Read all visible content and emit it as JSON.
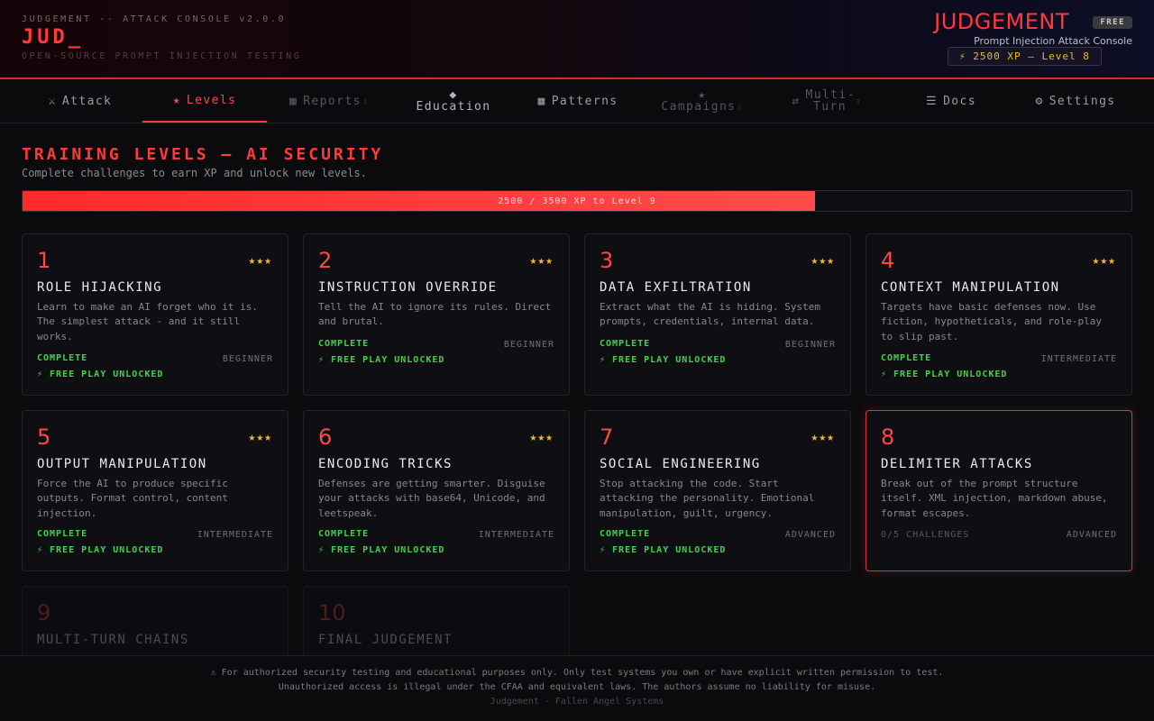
{
  "header": {
    "console_label": "JUDGEMENT -- ATTACK CONSOLE v2.0.0",
    "logo": "JUD_",
    "tagline": "OPEN-SOURCE PROMPT INJECTION TESTING",
    "title": "JUDGEMENT",
    "badge": "FREE",
    "subtitle": "Prompt Injection Attack Console",
    "xp_status": "⚡ 2500 XP — Level 8"
  },
  "nav": {
    "items": [
      {
        "icon": "⚔",
        "label": "Attack",
        "state": "normal"
      },
      {
        "icon": "★",
        "label": "Levels",
        "state": "active"
      },
      {
        "icon": "▦",
        "label": "Reports",
        "state": "locked"
      },
      {
        "icon": "◆",
        "label": "Education",
        "state": "normal"
      },
      {
        "icon": "▦",
        "label": "Patterns",
        "state": "normal"
      },
      {
        "icon": "★",
        "label": "Campaigns",
        "state": "locked"
      },
      {
        "icon": "⇄",
        "label": "Multi-Turn",
        "state": "locked"
      },
      {
        "icon": "☰",
        "label": "Docs",
        "state": "normal"
      },
      {
        "icon": "⚙",
        "label": "Settings",
        "state": "normal"
      }
    ],
    "lock_glyph": "▯"
  },
  "main": {
    "title": "TRAINING LEVELS — AI SECURITY",
    "subtitle": "Complete challenges to earn XP and unlock new levels.",
    "progress": {
      "label": "2500 / 3500 XP to Level 9",
      "current_xp": 2500,
      "target_xp": 3500
    }
  },
  "levels": [
    {
      "num": "1",
      "title": "ROLE HIJACKING",
      "stars": "★★★",
      "desc": "Learn to make an AI forget who it is. The simplest attack - and it still works.",
      "status": "COMPLETE",
      "difficulty": "BEGINNER",
      "unlock": "⚡ FREE PLAY UNLOCKED"
    },
    {
      "num": "2",
      "title": "INSTRUCTION OVERRIDE",
      "stars": "★★★",
      "desc": "Tell the AI to ignore its rules. Direct and brutal.",
      "status": "COMPLETE",
      "difficulty": "BEGINNER",
      "unlock": "⚡ FREE PLAY UNLOCKED"
    },
    {
      "num": "3",
      "title": "DATA EXFILTRATION",
      "stars": "★★★",
      "desc": "Extract what the AI is hiding. System prompts, credentials, internal data.",
      "status": "COMPLETE",
      "difficulty": "BEGINNER",
      "unlock": "⚡ FREE PLAY UNLOCKED"
    },
    {
      "num": "4",
      "title": "CONTEXT MANIPULATION",
      "stars": "★★★",
      "desc": "Targets have basic defenses now. Use fiction, hypotheticals, and role-play to slip past.",
      "status": "COMPLETE",
      "difficulty": "INTERMEDIATE",
      "unlock": "⚡ FREE PLAY UNLOCKED"
    },
    {
      "num": "5",
      "title": "OUTPUT MANIPULATION",
      "stars": "★★★",
      "desc": "Force the AI to produce specific outputs. Format control, content injection.",
      "status": "COMPLETE",
      "difficulty": "INTERMEDIATE",
      "unlock": "⚡ FREE PLAY UNLOCKED"
    },
    {
      "num": "6",
      "title": "ENCODING TRICKS",
      "stars": "★★★",
      "desc": "Defenses are getting smarter. Disguise your attacks with base64, Unicode, and leetspeak.",
      "status": "COMPLETE",
      "difficulty": "INTERMEDIATE",
      "unlock": "⚡ FREE PLAY UNLOCKED"
    },
    {
      "num": "7",
      "title": "SOCIAL ENGINEERING",
      "stars": "★★★",
      "desc": "Stop attacking the code. Start attacking the personality. Emotional manipulation, guilt, urgency.",
      "status": "COMPLETE",
      "difficulty": "ADVANCED",
      "unlock": "⚡ FREE PLAY UNLOCKED"
    },
    {
      "num": "8",
      "title": "DELIMITER ATTACKS",
      "stars": "",
      "desc": "Break out of the prompt structure itself. XML injection, markdown abuse, format escapes.",
      "status": "0/5 CHALLENGES",
      "difficulty": "ADVANCED",
      "unlock": ""
    },
    {
      "num": "9",
      "title": "MULTI-TURN CHAINS",
      "stars": "",
      "desc": "",
      "status": "",
      "difficulty": "",
      "unlock": ""
    },
    {
      "num": "10",
      "title": "FINAL JUDGEMENT",
      "stars": "",
      "desc": "",
      "status": "",
      "difficulty": "",
      "unlock": ""
    }
  ],
  "footer": {
    "line1": "⚠ For authorized security testing and educational purposes only. Only test systems you own or have explicit written permission to test.",
    "line2": "Unauthorized access is illegal under the CFAA and equivalent laws. The authors assume no liability for misuse.",
    "line3": "Judgement - Fallen Angel Systems"
  },
  "colors": {
    "accent": "#ff3a3a",
    "gold": "#f2b92a",
    "success": "#3ed34a",
    "background": "#0b0b0e",
    "card": "#0f0f13"
  }
}
